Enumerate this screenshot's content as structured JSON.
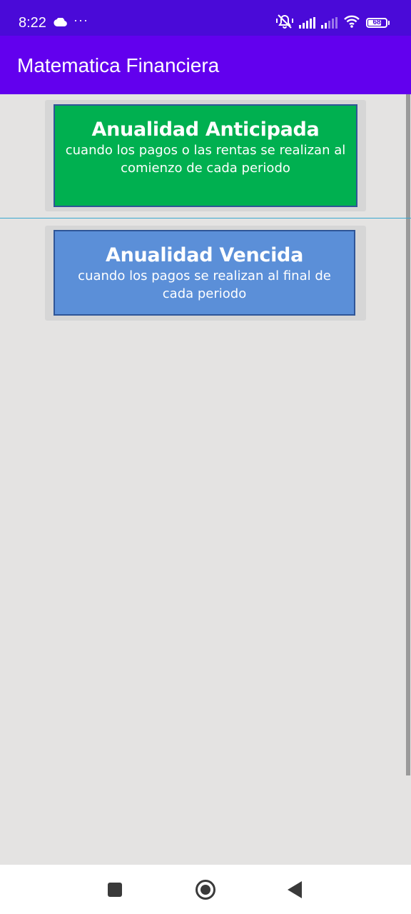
{
  "status_bar": {
    "time": "8:22",
    "icons": [
      "cloud-icon",
      "more-dots-icon",
      "mute-vibrate-icon",
      "signal-icon",
      "signal-icon",
      "wifi-icon",
      "battery-icon"
    ],
    "more": "···",
    "battery_level": "68",
    "color": "#4a0ad8"
  },
  "app_bar": {
    "title": "Matematica Financiera",
    "color": "#6200ee"
  },
  "cards": [
    {
      "title": "Anualidad Anticipada",
      "description": "cuando los pagos o las rentas se realizan al comienzo de cada periodo",
      "color": "#00b050"
    },
    {
      "title": "Anualidad Vencida",
      "description": "cuando los pagos se realizan al final de cada periodo",
      "color": "#5b8fd8"
    }
  ],
  "navigation": {
    "buttons": [
      "recent-apps-icon",
      "home-icon",
      "back-icon"
    ]
  }
}
